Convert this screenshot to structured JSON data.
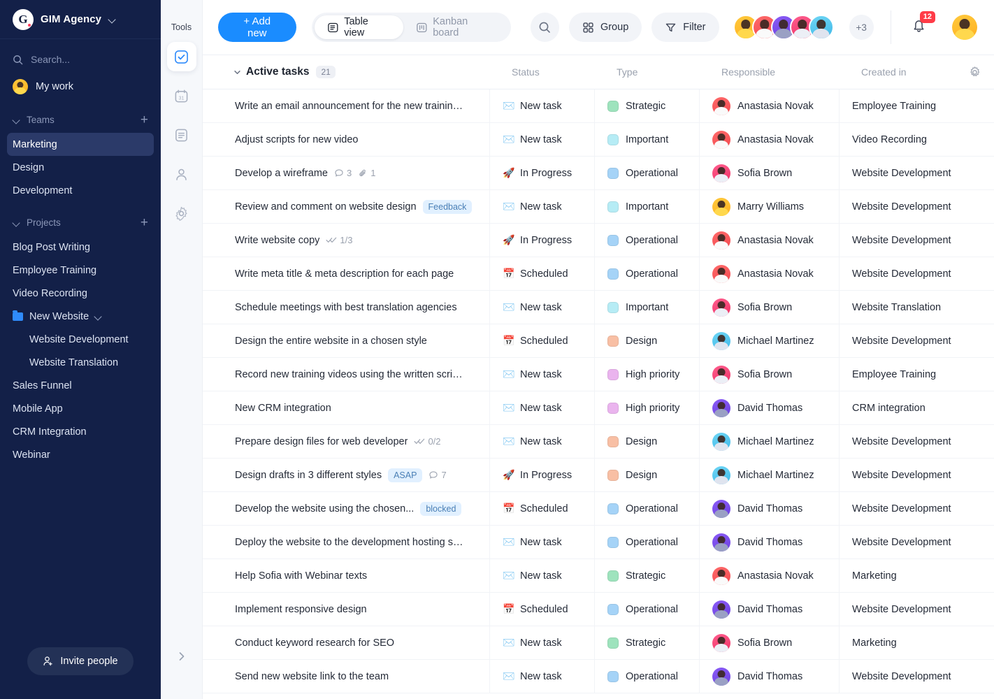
{
  "sidebar": {
    "brand": {
      "logo_letter": "G",
      "name": "GIM Agency",
      "chevron": "chevron-down-icon"
    },
    "search_placeholder": "Search...",
    "my_work": "My work",
    "teams_label": "Teams",
    "teams": [
      {
        "label": "Marketing",
        "active": true
      },
      {
        "label": "Design",
        "active": false
      },
      {
        "label": "Development",
        "active": false
      }
    ],
    "projects_label": "Projects",
    "projects": [
      {
        "label": "Blog Post Writing",
        "type": "item"
      },
      {
        "label": "Employee Training",
        "type": "item"
      },
      {
        "label": "Video Recording",
        "type": "item"
      },
      {
        "label": "New Website",
        "type": "folder"
      },
      {
        "label": "Website Development",
        "type": "sub"
      },
      {
        "label": "Website Translation",
        "type": "sub"
      },
      {
        "label": "Sales Funnel",
        "type": "item"
      },
      {
        "label": "Mobile App",
        "type": "item"
      },
      {
        "label": "CRM Integration",
        "type": "item"
      },
      {
        "label": "Webinar",
        "type": "item"
      }
    ],
    "invite_label": "Invite people"
  },
  "tools": {
    "title": "Tools",
    "items": [
      {
        "icon": "tasks-check-icon",
        "active": true
      },
      {
        "icon": "calendar-icon",
        "active": false
      },
      {
        "icon": "document-icon",
        "active": false
      },
      {
        "icon": "person-icon",
        "active": false
      },
      {
        "icon": "gear-icon",
        "active": false
      }
    ],
    "expand_icon": "chevron-right-icon"
  },
  "topbar": {
    "add_new": "+ Add new",
    "views": [
      {
        "label": "Table view",
        "icon": "table-icon",
        "active": true
      },
      {
        "label": "Kanban board",
        "icon": "kanban-icon",
        "active": false
      }
    ],
    "search_icon": "search-icon",
    "group_label": "Group",
    "group_icon": "grid-icon",
    "filter_label": "Filter",
    "filter_icon": "funnel-icon",
    "avatars": [
      "yellow",
      "red",
      "purple",
      "magenta",
      "cyan"
    ],
    "avatar_overflow": "+3",
    "notifications_count": "12",
    "bell_icon": "bell-icon",
    "user_avatar": "yellow"
  },
  "table": {
    "group_title": "Active tasks",
    "group_count": "21",
    "collapse_icon": "chevron-down-icon",
    "settings_icon": "gear-icon",
    "columns": [
      "",
      "Status",
      "Type",
      "Responsible",
      "Created in"
    ],
    "status_colors": {
      "New task": "#c8ccd4",
      "In Progress": "#ff6b3d",
      "Scheduled": "#d46a6a"
    },
    "type_colors": {
      "Strategic": "#9ee3bd",
      "Important": "#b6ecf5",
      "Operational": "#a5d3f7",
      "Design": "#f8bfa4",
      "High priority": "#eab4ee"
    },
    "rows": [
      {
        "task": "Write an email announcement for the new training...",
        "tag": "",
        "meta": [],
        "status": "New task",
        "status_icon": "envelope-emoji",
        "type": "Strategic",
        "responsible": "Anastasia Novak",
        "avatar": "red",
        "project": "Employee Training"
      },
      {
        "task": "Adjust scripts for new video",
        "tag": "",
        "meta": [],
        "status": "New task",
        "status_icon": "envelope-emoji",
        "type": "Important",
        "responsible": "Anastasia Novak",
        "avatar": "red",
        "project": "Video Recording"
      },
      {
        "task": "Develop a wireframe",
        "tag": "",
        "meta": [
          {
            "icon": "comment-icon",
            "value": "3"
          },
          {
            "icon": "attachment-icon",
            "value": "1"
          }
        ],
        "status": "In Progress",
        "status_icon": "rocket-emoji",
        "type": "Operational",
        "responsible": "Sofia Brown",
        "avatar": "magenta",
        "project": "Website Development"
      },
      {
        "task": "Review and comment on website design",
        "tag": "Feedback",
        "meta": [],
        "status": "New task",
        "status_icon": "envelope-emoji",
        "type": "Important",
        "responsible": "Marry Williams",
        "avatar": "yellow",
        "project": "Website Development"
      },
      {
        "task": "Write website copy",
        "tag": "",
        "meta": [
          {
            "icon": "checklist-icon",
            "value": "1/3"
          }
        ],
        "status": "In Progress",
        "status_icon": "rocket-emoji",
        "type": "Operational",
        "responsible": "Anastasia Novak",
        "avatar": "red",
        "project": "Website Development"
      },
      {
        "task": "Write meta title & meta description for each page",
        "tag": "",
        "meta": [],
        "status": "Scheduled",
        "status_icon": "calendar-emoji",
        "type": "Operational",
        "responsible": "Anastasia Novak",
        "avatar": "red",
        "project": "Website Development"
      },
      {
        "task": "Schedule meetings with best translation agencies",
        "tag": "",
        "meta": [],
        "status": "New task",
        "status_icon": "envelope-emoji",
        "type": "Important",
        "responsible": "Sofia Brown",
        "avatar": "magenta",
        "project": "Website Translation"
      },
      {
        "task": "Design the entire website in a chosen style",
        "tag": "",
        "meta": [],
        "status": "Scheduled",
        "status_icon": "calendar-emoji",
        "type": "Design",
        "responsible": "Michael Martinez",
        "avatar": "cyan",
        "project": "Website Development"
      },
      {
        "task": "Record new training videos using the written scripts",
        "tag": "",
        "meta": [],
        "status": "New task",
        "status_icon": "envelope-emoji",
        "type": "High priority",
        "responsible": "Sofia Brown",
        "avatar": "magenta",
        "project": "Employee Training"
      },
      {
        "task": "New CRM integration",
        "tag": "",
        "meta": [],
        "status": "New task",
        "status_icon": "envelope-emoji",
        "type": "High priority",
        "responsible": "David Thomas",
        "avatar": "purple",
        "project": "CRM integration"
      },
      {
        "task": "Prepare design files for web developer",
        "tag": "",
        "meta": [
          {
            "icon": "checklist-icon",
            "value": "0/2"
          }
        ],
        "status": "New task",
        "status_icon": "envelope-emoji",
        "type": "Design",
        "responsible": "Michael Martinez",
        "avatar": "cyan",
        "project": "Website Development"
      },
      {
        "task": "Design drafts in 3 different styles",
        "tag": "ASAP",
        "meta": [
          {
            "icon": "comment-icon",
            "value": "7"
          }
        ],
        "status": "In Progress",
        "status_icon": "rocket-emoji",
        "type": "Design",
        "responsible": "Michael Martinez",
        "avatar": "cyan",
        "project": "Website Development"
      },
      {
        "task": "Develop the website using the chosen...",
        "tag": "blocked",
        "meta": [],
        "status": "Scheduled",
        "status_icon": "calendar-emoji",
        "type": "Operational",
        "responsible": "David Thomas",
        "avatar": "purple",
        "project": "Website Development"
      },
      {
        "task": "Deploy the website to the development hosting server",
        "tag": "",
        "meta": [],
        "status": "New task",
        "status_icon": "envelope-emoji",
        "type": "Operational",
        "responsible": "David Thomas",
        "avatar": "purple",
        "project": "Website Development"
      },
      {
        "task": "Help Sofia with Webinar texts",
        "tag": "",
        "meta": [],
        "status": "New task",
        "status_icon": "envelope-emoji",
        "type": "Strategic",
        "responsible": "Anastasia Novak",
        "avatar": "red",
        "project": "Marketing"
      },
      {
        "task": "Implement responsive design",
        "tag": "",
        "meta": [],
        "status": "Scheduled",
        "status_icon": "calendar-emoji",
        "type": "Operational",
        "responsible": "David Thomas",
        "avatar": "purple",
        "project": "Website Development"
      },
      {
        "task": "Conduct keyword research for SEO",
        "tag": "",
        "meta": [],
        "status": "New task",
        "status_icon": "envelope-emoji",
        "type": "Strategic",
        "responsible": "Sofia Brown",
        "avatar": "magenta",
        "project": "Marketing"
      },
      {
        "task": "Send new website link to the team",
        "tag": "",
        "meta": [],
        "status": "New task",
        "status_icon": "envelope-emoji",
        "type": "Operational",
        "responsible": "David Thomas",
        "avatar": "purple",
        "project": "Website Development"
      }
    ]
  }
}
